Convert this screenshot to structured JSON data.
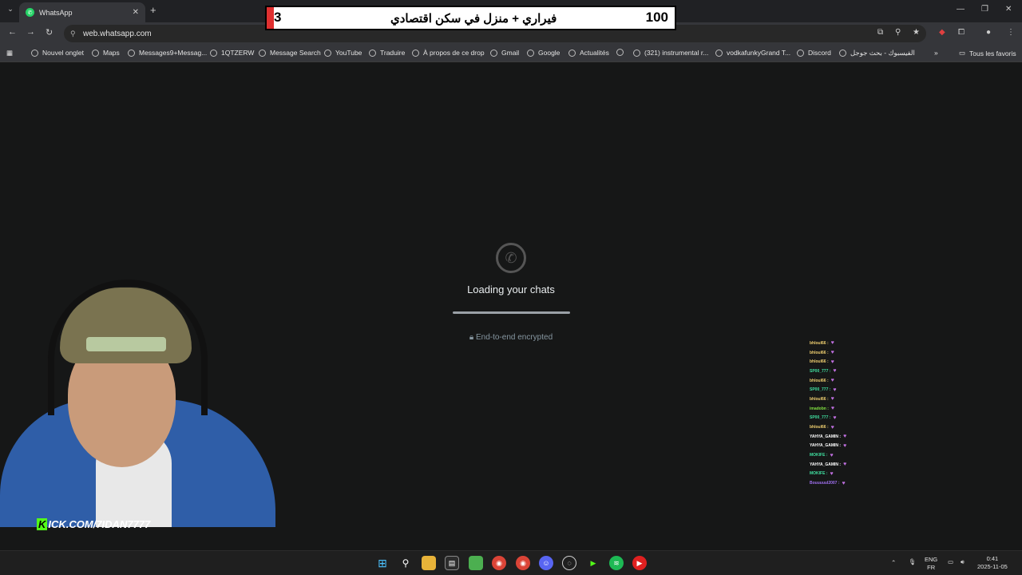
{
  "browser": {
    "tab_title": "WhatsApp",
    "url": "web.whatsapp.com",
    "bookmarks": [
      "Nouvel onglet",
      "Maps",
      "Messages9+Messag...",
      "1QTZERW",
      "Message Search",
      "YouTube",
      "Traduire",
      "À propos de ce drop",
      "Gmail",
      "Google",
      "Actualités",
      "",
      "(321) instrumental r...",
      "vodkafunkyGrand T...",
      "Discord",
      "الفيسبوك - بحث جوجل"
    ],
    "all_bookmarks_label": "Tous les favoris"
  },
  "overlay": {
    "left_number": "3",
    "arabic_text": "فيراري + منزل في سكن اقتصادي",
    "right_number": "100",
    "accent": "#e03030"
  },
  "whatsapp": {
    "loading_text": "Loading your chats",
    "progress": 1.0,
    "encrypted_text": "End-to-end encrypted"
  },
  "stream": {
    "kick_text": "KICK.COM/7IDAN7777"
  },
  "chat": [
    {
      "user": "bhloul66 :",
      "color": "#f0d070"
    },
    {
      "user": "bhloul66 :",
      "color": "#f0d070"
    },
    {
      "user": "bhloul66 :",
      "color": "#f0d070"
    },
    {
      "user": "SP00_777 :",
      "color": "#40e0a0"
    },
    {
      "user": "bhloul66 :",
      "color": "#f0d070"
    },
    {
      "user": "SP00_777 :",
      "color": "#40e0a0"
    },
    {
      "user": "bhloul66 :",
      "color": "#f0d070"
    },
    {
      "user": "imadobn :",
      "color": "#80e040"
    },
    {
      "user": "SP00_777 :",
      "color": "#40e0a0"
    },
    {
      "user": "bhloul66 :",
      "color": "#f0d070"
    },
    {
      "user": "YAHYA_GAMIN :",
      "color": "#ffffff"
    },
    {
      "user": "YAHYA_GAMIN :",
      "color": "#ffffff"
    },
    {
      "user": "MOKIFE :",
      "color": "#40e0a0"
    },
    {
      "user": "YAHYA_GAMIN :",
      "color": "#ffffff"
    },
    {
      "user": "MOKIFE :",
      "color": "#40e0a0"
    },
    {
      "user": "Bouuuuul2007 :",
      "color": "#a070f0"
    }
  ],
  "taskbar": {
    "lang_top": "ENG",
    "lang_bottom": "FR",
    "time": "0:41",
    "date": "2025-11-05"
  }
}
